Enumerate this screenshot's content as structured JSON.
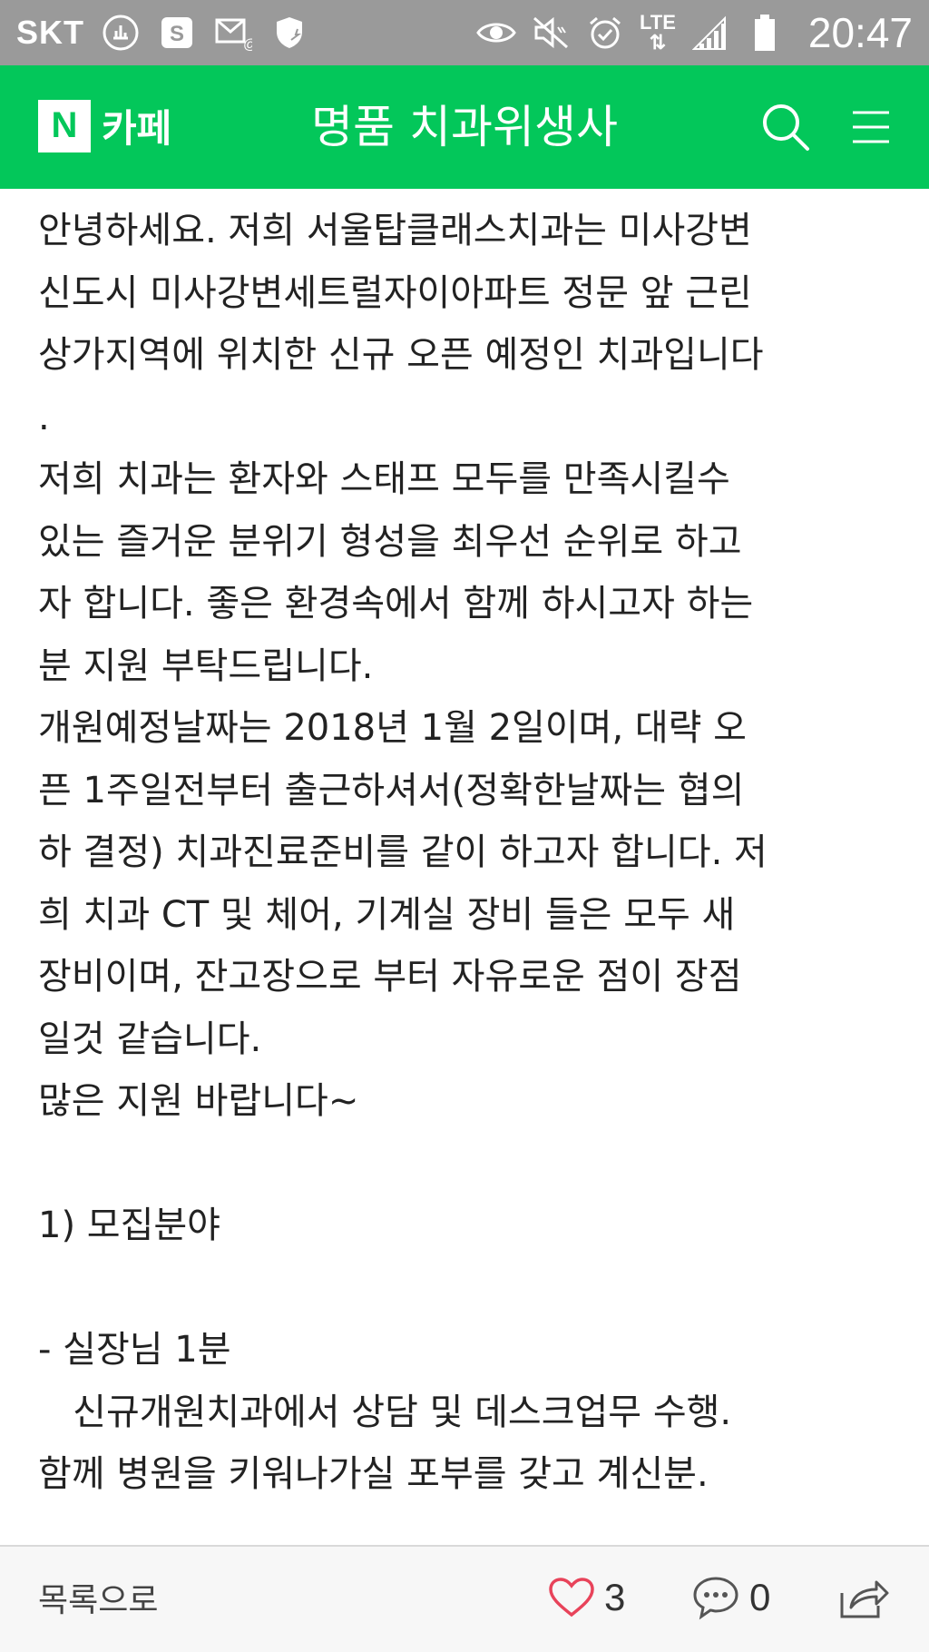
{
  "status_bar": {
    "carrier": "SKT",
    "network": "LTE",
    "time": "20:47",
    "left_icons": [
      "usb-icon",
      "samsung-pay-icon",
      "email-icon",
      "shield-icon"
    ],
    "right_icons": [
      "eye-comfort-icon",
      "mute-icon",
      "alarm-icon",
      "signal-icon",
      "battery-icon"
    ]
  },
  "header": {
    "logo_letter": "N",
    "brand": "카페",
    "cafe_name": "명품 치과위생사",
    "accent_color": "#03c75a"
  },
  "post": {
    "lines": [
      "안녕하세요. 저희 서울탑클래스치과는 미사강변",
      "신도시 미사강변세트럴자이아파트 정문 앞 근린",
      "상가지역에 위치한 신규 오픈 예정인 치과입니다",
      ".",
      "저희 치과는 환자와 스태프 모두를 만족시킬수",
      "있는 즐거운 분위기 형성을 최우선 순위로 하고",
      "자 합니다. 좋은 환경속에서 함께 하시고자 하는",
      "분 지원 부탁드립니다.",
      "개원예정날짜는 2018년 1월 2일이며, 대략 오",
      "픈 1주일전부터 출근하셔서(정확한날짜는 협의",
      "하 결정) 치과진료준비를 같이 하고자 합니다. 저",
      "희 치과 CT 및 체어, 기계실 장비 들은 모두 새",
      "장비이며, 잔고장으로 부터 자유로운 점이 장점",
      "일것 같습니다.",
      "많은 지원 바랍니다~",
      "",
      "1) 모집분야",
      "",
      "- 실장님 1분",
      "   신규개원치과에서 상담 및 데스크업무 수행.",
      "함께 병원을 키워나가실 포부를 갖고 계신분."
    ]
  },
  "bottom_bar": {
    "back_label": "목록으로",
    "likes": "3",
    "comments": "0",
    "like_color": "#e8435a"
  }
}
